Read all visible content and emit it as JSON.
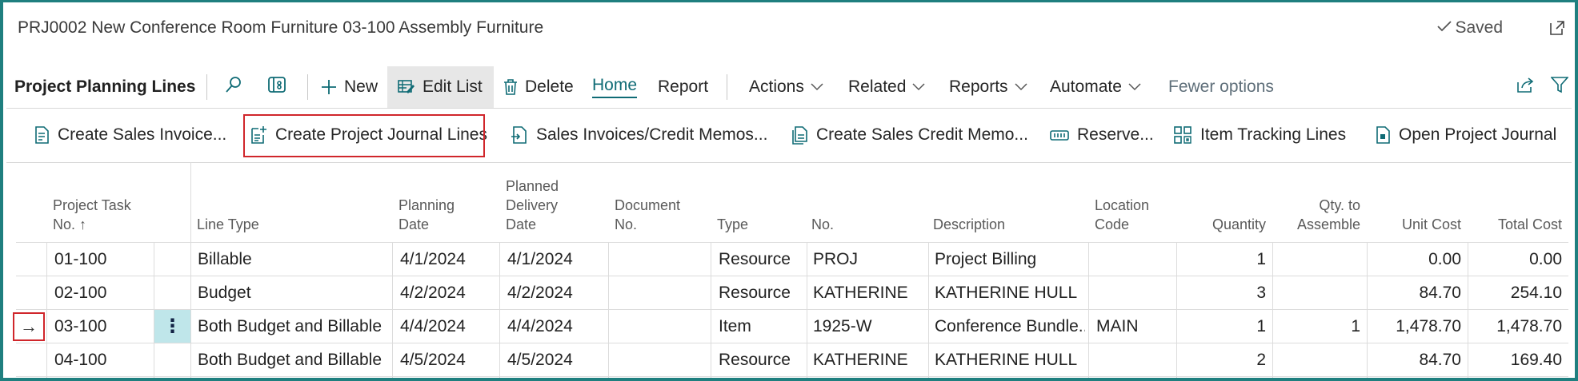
{
  "header": {
    "title": "PRJ0002 New Conference Room Furniture 03-100 Assembly Furniture",
    "saved_label": "Saved"
  },
  "actionbar": {
    "title": "Project Planning Lines",
    "new_label": "New",
    "edit_list_label": "Edit List",
    "delete_label": "Delete",
    "home_label": "Home",
    "report_label": "Report",
    "actions_label": "Actions",
    "related_label": "Related",
    "reports_label": "Reports",
    "automate_label": "Automate",
    "fewer_label": "Fewer options"
  },
  "promoted": {
    "create_sales_invoice": "Create Sales Invoice...",
    "create_project_journal_lines": "Create Project Journal Lines",
    "sales_invoices_credit_memos": "Sales Invoices/Credit Memos...",
    "create_sales_credit_memo": "Create Sales Credit Memo...",
    "reserve": "Reserve...",
    "item_tracking_lines": "Item Tracking Lines",
    "open_project_journal": "Open Project Journal"
  },
  "table": {
    "headers": {
      "project_task_no_1": "Project Task",
      "project_task_no_2": "No. ↑",
      "line_type": "Line Type",
      "planning_date_1": "Planning",
      "planning_date_2": "Date",
      "planned_delivery_1": "Planned",
      "planned_delivery_2": "Delivery",
      "planned_delivery_3": "Date",
      "document_no_1": "Document",
      "document_no_2": "No.",
      "type": "Type",
      "no": "No.",
      "description": "Description",
      "location_code_1": "Location",
      "location_code_2": "Code",
      "quantity": "Quantity",
      "qty_to_assemble_1": "Qty. to",
      "qty_to_assemble_2": "Assemble",
      "unit_cost": "Unit Cost",
      "total_cost": "Total Cost"
    },
    "rows": [
      {
        "task": "01-100",
        "line_type": "Billable",
        "planning_date": "4/1/2024",
        "delivery_date": "4/1/2024",
        "document_no": "",
        "type": "Resource",
        "no": "PROJ",
        "description": "Project Billing",
        "location": "",
        "quantity": "1",
        "qty_assemble": "",
        "unit_cost": "0.00",
        "total_cost": "0.00"
      },
      {
        "task": "02-100",
        "line_type": "Budget",
        "planning_date": "4/2/2024",
        "delivery_date": "4/2/2024",
        "document_no": "",
        "type": "Resource",
        "no": "KATHERINE",
        "description": "KATHERINE HULL",
        "location": "",
        "quantity": "3",
        "qty_assemble": "",
        "unit_cost": "84.70",
        "total_cost": "254.10"
      },
      {
        "task": "03-100",
        "line_type": "Both Budget and Billable",
        "planning_date": "4/4/2024",
        "delivery_date": "4/4/2024",
        "document_no": "",
        "type": "Item",
        "no": "1925-W",
        "description": "Conference Bundle...",
        "location": "MAIN",
        "quantity": "1",
        "qty_assemble": "1",
        "unit_cost": "1,478.70",
        "total_cost": "1,478.70"
      },
      {
        "task": "04-100",
        "line_type": "Both Budget and Billable",
        "planning_date": "4/5/2024",
        "delivery_date": "4/5/2024",
        "document_no": "",
        "type": "Resource",
        "no": "KATHERINE",
        "description": "KATHERINE HULL",
        "location": "",
        "quantity": "2",
        "qty_assemble": "",
        "unit_cost": "84.70",
        "total_cost": "169.40"
      }
    ],
    "row_indicator": "→",
    "row_menu": "⋮"
  },
  "colors": {
    "frame": "#1f7f7f",
    "accent": "#0f6b75",
    "highlight": "#d0262b",
    "row_menu_bg": "#bfe6ea"
  },
  "icons": [
    "search-icon",
    "filter-pane-icon",
    "plus-icon",
    "edit-list-icon",
    "trash-icon",
    "share-icon",
    "filter-icon",
    "popout-icon",
    "check-icon"
  ]
}
